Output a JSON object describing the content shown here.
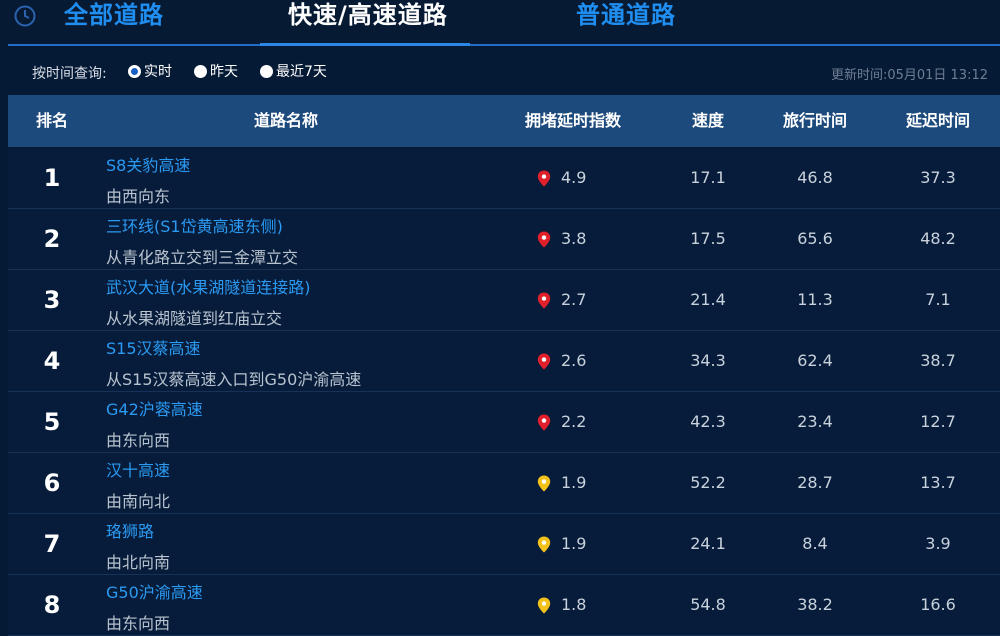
{
  "tabs": {
    "all": "全部道路",
    "fast": "快速/高速道路",
    "normal": "普通道路"
  },
  "filter": {
    "label": "按时间查询:",
    "options": [
      "实时",
      "昨天",
      "最近7天"
    ],
    "selected": "实时",
    "updated": "更新时间:05月01日 13:12"
  },
  "table": {
    "headers": {
      "rank": "排名",
      "name": "道路名称",
      "index": "拥堵延时指数",
      "speed": "速度",
      "travel": "旅行时间",
      "delay": "延迟时间"
    },
    "rows": [
      {
        "rank": "1",
        "name": "S8关豹高速",
        "dir": "由西向东",
        "index": "4.9",
        "level": "red",
        "speed": "17.1",
        "travel": "46.8",
        "delay": "37.3"
      },
      {
        "rank": "2",
        "name": "三环线(S1岱黄高速东侧)",
        "dir": "从青化路立交到三金潭立交",
        "index": "3.8",
        "level": "red",
        "speed": "17.5",
        "travel": "65.6",
        "delay": "48.2"
      },
      {
        "rank": "3",
        "name": "武汉大道(水果湖隧道连接路)",
        "dir": "从水果湖隧道到红庙立交",
        "index": "2.7",
        "level": "red",
        "speed": "21.4",
        "travel": "11.3",
        "delay": "7.1"
      },
      {
        "rank": "4",
        "name": "S15汉蔡高速",
        "dir": "从S15汉蔡高速入口到G50沪渝高速",
        "index": "2.6",
        "level": "red",
        "speed": "34.3",
        "travel": "62.4",
        "delay": "38.7"
      },
      {
        "rank": "5",
        "name": "G42沪蓉高速",
        "dir": "由东向西",
        "index": "2.2",
        "level": "red",
        "speed": "42.3",
        "travel": "23.4",
        "delay": "12.7"
      },
      {
        "rank": "6",
        "name": "汉十高速",
        "dir": "由南向北",
        "index": "1.9",
        "level": "yellow",
        "speed": "52.2",
        "travel": "28.7",
        "delay": "13.7"
      },
      {
        "rank": "7",
        "name": "珞狮路",
        "dir": "由北向南",
        "index": "1.9",
        "level": "yellow",
        "speed": "24.1",
        "travel": "8.4",
        "delay": "3.9"
      },
      {
        "rank": "8",
        "name": "G50沪渝高速",
        "dir": "由东向西",
        "index": "1.8",
        "level": "yellow",
        "speed": "54.8",
        "travel": "38.2",
        "delay": "16.6"
      }
    ]
  },
  "colors": {
    "red": "#e0212c",
    "yellow": "#f2c21b",
    "accent": "#1f8ef0"
  }
}
